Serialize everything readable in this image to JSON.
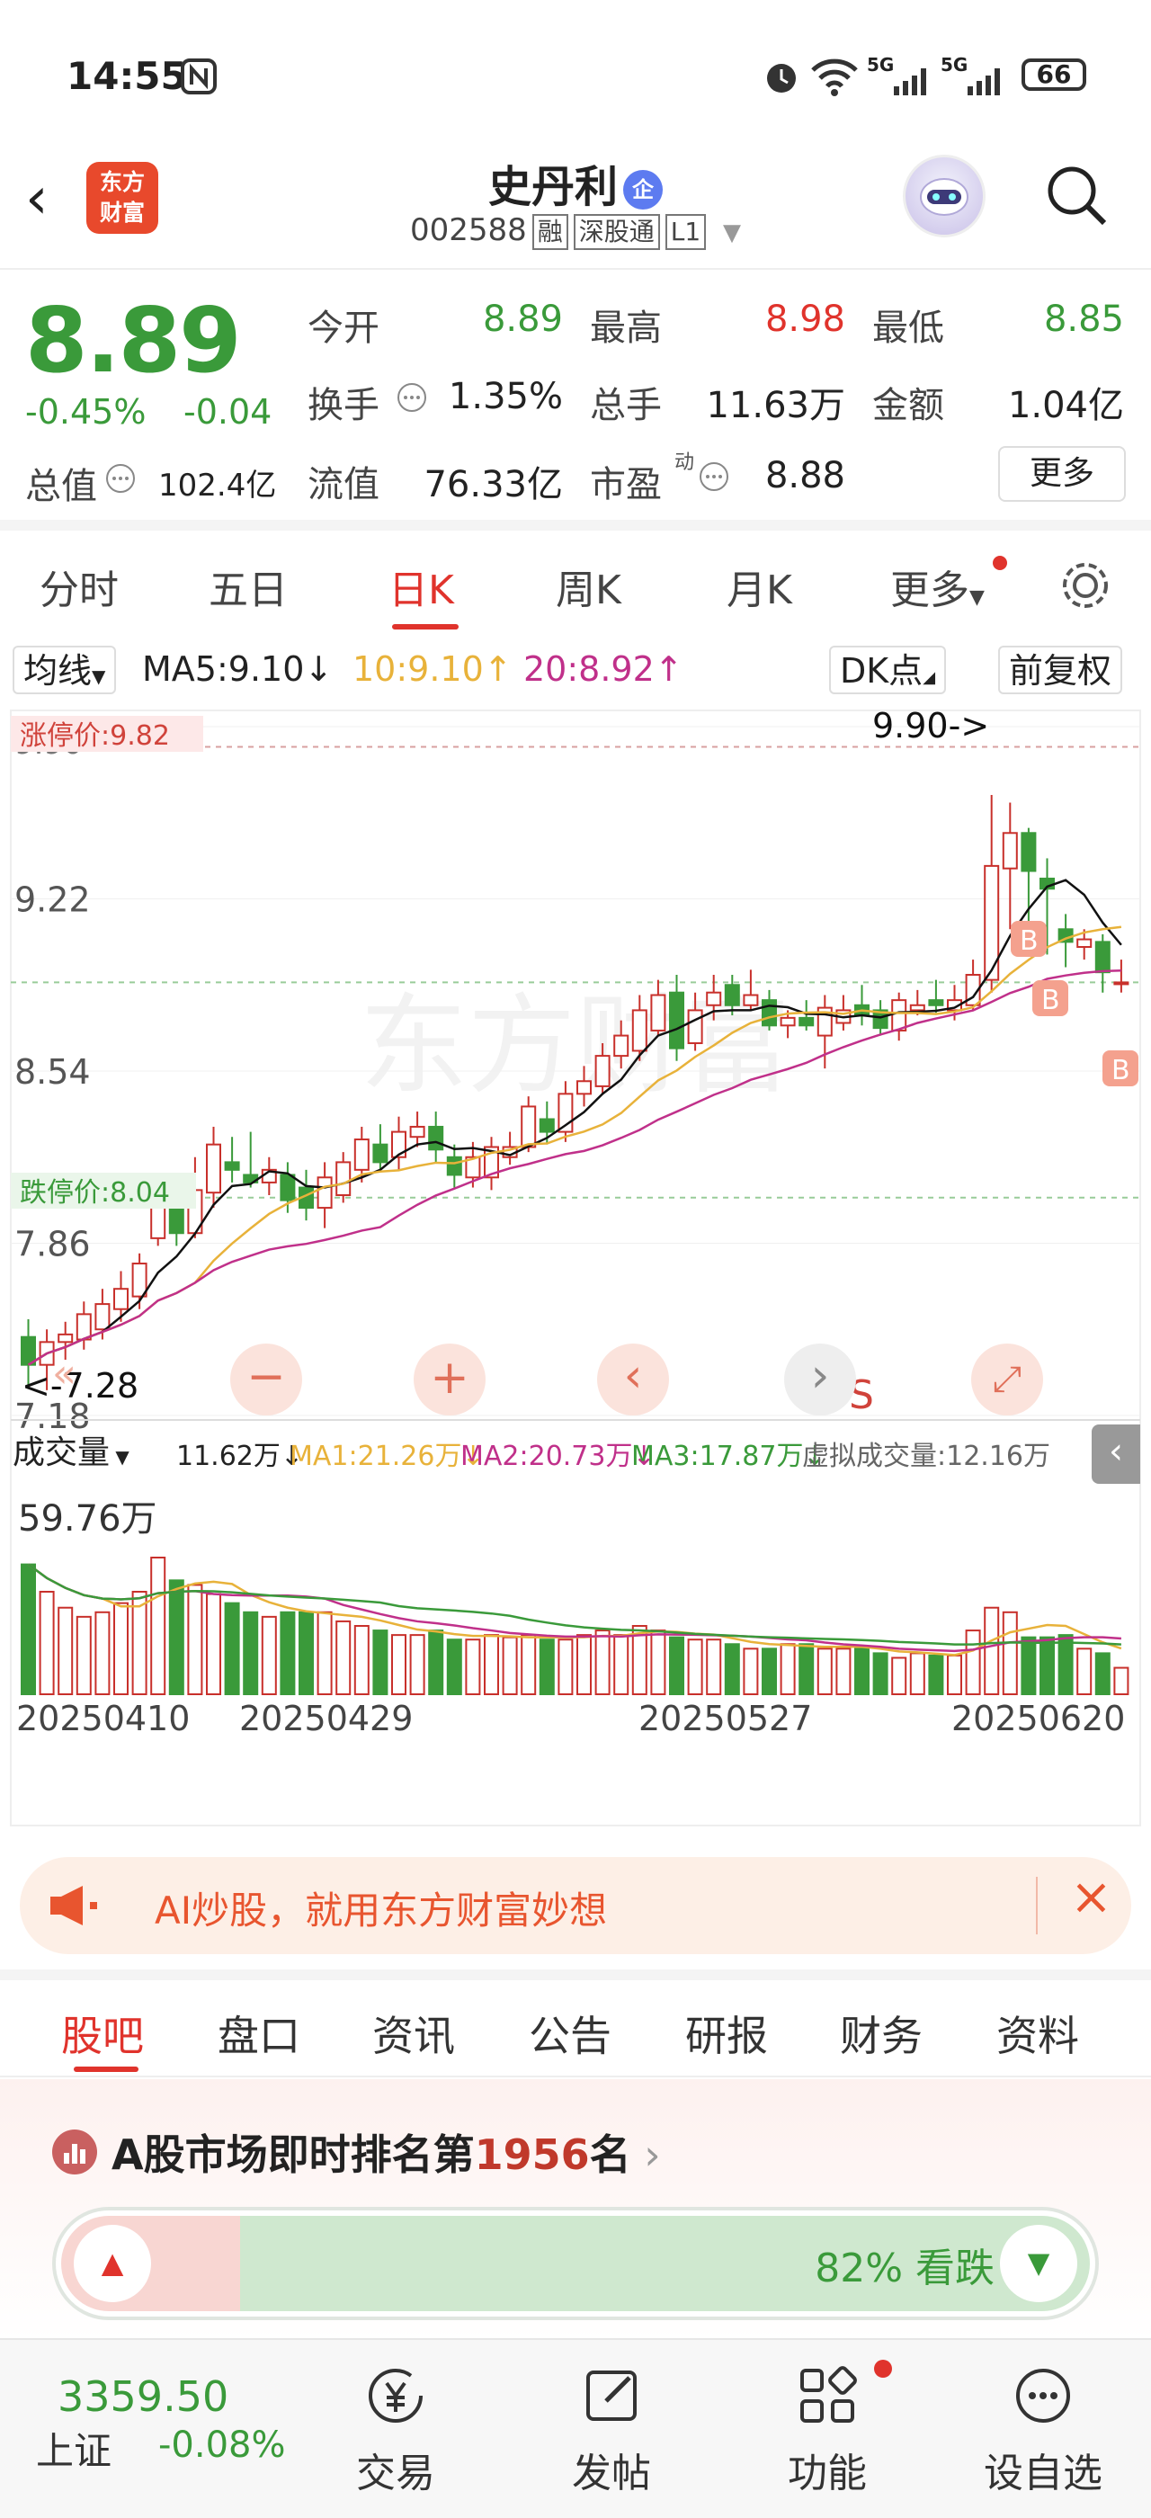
{
  "status_bar": {
    "time": "14:55",
    "battery": "66",
    "net1": "5G",
    "net2": "5G"
  },
  "header": {
    "logo_line1": "东方",
    "logo_line2": "财富",
    "stock_name": "史丹利",
    "qi_badge": "企",
    "stock_code": "002588",
    "tags": [
      "融",
      "深股通",
      "L1"
    ]
  },
  "quote": {
    "price": "8.89",
    "change_pct": "-0.45%",
    "change": "-0.04",
    "open_label": "今开",
    "open": "8.89",
    "high_label": "最高",
    "high": "8.98",
    "low_label": "最低",
    "low": "8.85",
    "turnover_label": "换手",
    "turnover": "1.35%",
    "volume_label": "总手",
    "volume": "11.63万",
    "amount_label": "金额",
    "amount": "1.04亿",
    "mktcap_label": "总值",
    "mktcap": "102.4亿",
    "float_label": "流值",
    "float_cap": "76.33亿",
    "pe_label": "市盈",
    "pe_sup": "动",
    "pe": "8.88",
    "more_label": "更多"
  },
  "period_tabs": [
    "分时",
    "五日",
    "日K",
    "周K",
    "月K",
    "更多"
  ],
  "chart_controls": {
    "indicator": "均线",
    "ma5": "MA5:9.10↓",
    "ma10": "10:9.10↑",
    "ma20": "20:8.92↑",
    "dk": "DK点",
    "adjust": "前复权",
    "limit_up": "涨停价:9.82",
    "limit_down": "跌停价:8.04",
    "high_note": "9.90->",
    "low_note": "<-7.28",
    "top_tick": "9.90",
    "s_label": "S",
    "b_label": "B",
    "watermark": "东方财富"
  },
  "chart_data": {
    "type": "candlestick",
    "ytick_labels": [
      "9.90",
      "9.22",
      "8.54",
      "7.86",
      "7.18"
    ],
    "x_tick_labels": [
      "20250410",
      "20250429",
      "20250527",
      "20250620"
    ],
    "candles": [
      [
        7.49,
        7.38,
        7.56,
        7.3
      ],
      [
        7.38,
        7.47,
        7.52,
        7.28
      ],
      [
        7.47,
        7.5,
        7.55,
        7.4
      ],
      [
        7.48,
        7.58,
        7.63,
        7.44
      ],
      [
        7.52,
        7.62,
        7.68,
        7.48
      ],
      [
        7.6,
        7.68,
        7.75,
        7.55
      ],
      [
        7.65,
        7.78,
        7.82,
        7.6
      ],
      [
        7.88,
        8.06,
        8.1,
        7.85
      ],
      [
        8.05,
        7.9,
        8.12,
        7.85
      ],
      [
        7.9,
        8.07,
        8.2,
        7.88
      ],
      [
        8.06,
        8.25,
        8.32,
        8.0
      ],
      [
        8.18,
        8.15,
        8.28,
        8.1
      ],
      [
        8.13,
        8.1,
        8.3,
        8.08
      ],
      [
        8.1,
        8.15,
        8.2,
        8.05
      ],
      [
        8.13,
        8.03,
        8.18,
        7.98
      ],
      [
        8.08,
        8.0,
        8.15,
        7.95
      ],
      [
        8.0,
        8.12,
        8.18,
        7.92
      ],
      [
        8.05,
        8.18,
        8.22,
        8.02
      ],
      [
        8.15,
        8.27,
        8.32,
        8.1
      ],
      [
        8.25,
        8.18,
        8.33,
        8.15
      ],
      [
        8.2,
        8.3,
        8.36,
        8.15
      ],
      [
        8.28,
        8.32,
        8.38,
        8.24
      ],
      [
        8.32,
        8.23,
        8.38,
        8.18
      ],
      [
        8.2,
        8.13,
        8.25,
        8.08
      ],
      [
        8.12,
        8.2,
        8.26,
        8.08
      ],
      [
        8.12,
        8.24,
        8.28,
        8.07
      ],
      [
        8.2,
        8.24,
        8.3,
        8.17
      ],
      [
        8.24,
        8.4,
        8.44,
        8.22
      ],
      [
        8.35,
        8.3,
        8.42,
        8.25
      ],
      [
        8.3,
        8.45,
        8.5,
        8.26
      ],
      [
        8.45,
        8.5,
        8.56,
        8.4
      ],
      [
        8.48,
        8.6,
        8.65,
        8.45
      ],
      [
        8.6,
        8.68,
        8.74,
        8.55
      ],
      [
        8.62,
        8.78,
        8.84,
        8.58
      ],
      [
        8.7,
        8.84,
        8.9,
        8.68
      ],
      [
        8.85,
        8.63,
        8.92,
        8.58
      ],
      [
        8.65,
        8.78,
        8.85,
        8.62
      ],
      [
        8.8,
        8.85,
        8.92,
        8.74
      ],
      [
        8.88,
        8.8,
        8.92,
        8.76
      ],
      [
        8.8,
        8.84,
        8.94,
        8.78
      ],
      [
        8.82,
        8.72,
        8.86,
        8.7
      ],
      [
        8.72,
        8.75,
        8.78,
        8.67
      ],
      [
        8.75,
        8.72,
        8.82,
        8.7
      ],
      [
        8.68,
        8.79,
        8.84,
        8.55
      ],
      [
        8.73,
        8.78,
        8.84,
        8.7
      ],
      [
        8.8,
        8.76,
        8.88,
        8.72
      ],
      [
        8.78,
        8.71,
        8.82,
        8.68
      ],
      [
        8.7,
        8.82,
        8.85,
        8.66
      ],
      [
        8.78,
        8.8,
        8.86,
        8.76
      ],
      [
        8.82,
        8.8,
        8.9,
        8.77
      ],
      [
        8.78,
        8.82,
        8.88,
        8.74
      ],
      [
        8.8,
        8.92,
        8.98,
        8.78
      ],
      [
        8.9,
        9.35,
        9.63,
        8.85
      ],
      [
        9.34,
        9.48,
        9.6,
        9.1
      ],
      [
        9.48,
        9.33,
        9.5,
        9.06
      ],
      [
        9.3,
        9.26,
        9.38,
        9.0
      ],
      [
        9.1,
        9.05,
        9.16,
        8.95
      ],
      [
        9.03,
        9.06,
        9.1,
        8.98
      ],
      [
        9.05,
        8.93,
        9.08,
        8.85
      ],
      [
        8.89,
        8.89,
        8.98,
        8.85
      ]
    ],
    "vol_unit": "万",
    "vol_peak_label": "59.76万",
    "volumes": [
      57,
      45,
      38,
      34,
      36,
      40,
      45,
      60,
      50,
      48,
      44,
      40,
      36,
      34,
      36,
      36,
      36,
      32,
      30,
      28,
      26,
      26,
      28,
      24,
      24,
      26,
      25,
      26,
      24,
      24,
      26,
      28,
      26,
      30,
      28,
      25,
      24,
      24,
      22,
      20,
      20,
      22,
      22,
      20,
      20,
      20,
      18,
      16,
      18,
      17,
      17,
      28,
      38,
      36,
      25,
      25,
      26,
      20,
      18,
      11.62
    ],
    "ma_lines": [
      "MA5",
      "MA10",
      "MA20"
    ]
  },
  "volume_panel": {
    "label": "成交量",
    "current": "11.62万↓",
    "ma1": "MA1:21.26万↓",
    "ma2": "MA2:20.73万↓",
    "ma3": "MA3:17.87万↓",
    "virtual": "虚拟成交量:12.16万"
  },
  "colors": {
    "up": "#c8302b",
    "down": "#3a9a3a",
    "ma5": "#111111",
    "ma10": "#e8b23a",
    "ma20": "#c0308a",
    "accent": "#e0332c"
  },
  "ad": {
    "text": "AI炒股，就用东方财富妙想"
  },
  "bottom_tabs": [
    "股吧",
    "盘口",
    "资讯",
    "公告",
    "研报",
    "财务",
    "资料"
  ],
  "rank": {
    "prefix": "A股市场即时排名第",
    "number": "1956",
    "suffix": "名",
    "bear_fraction": 0.82,
    "bear_text": "82% 看跌"
  },
  "bottom_nav": {
    "index_value": "3359.50",
    "index_name": "上证",
    "index_change": "-0.08%",
    "items": [
      "交易",
      "发帖",
      "功能",
      "设自选"
    ]
  }
}
